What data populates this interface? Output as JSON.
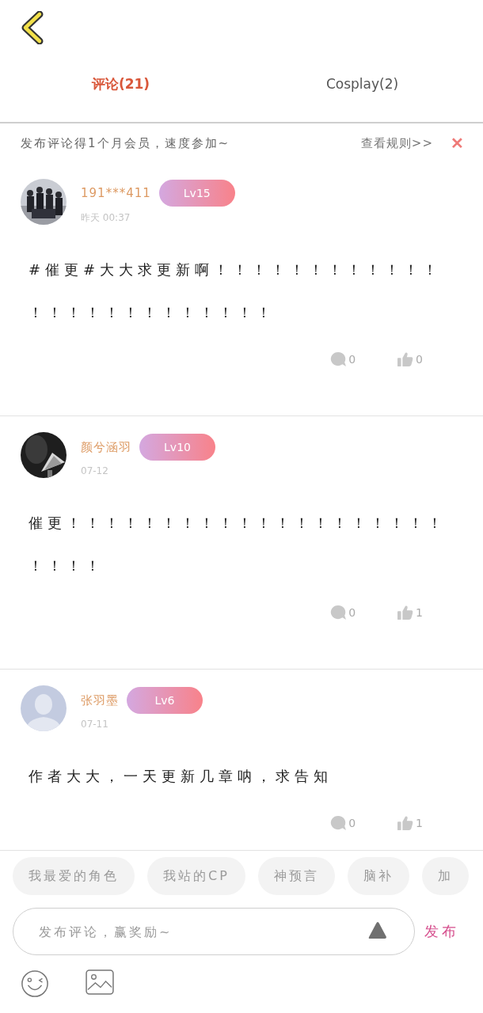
{
  "tabs": [
    {
      "label": "评论(21)",
      "selected": true
    },
    {
      "label": "Cosplay(2)",
      "selected": false
    }
  ],
  "banner": {
    "text": "发布评论得1个月会员，速度参加~",
    "link": "查看规则>>",
    "close": "✕"
  },
  "comments": [
    {
      "kind": "picture",
      "user": "191***411",
      "level": "Lv15",
      "time": "昨天 00:37",
      "text": "#催更#大大求更新啊！！！！！！！！！！！！！！！！！！！！！！！！！",
      "replies": "0",
      "likes": "0"
    },
    {
      "kind": "picture",
      "user": "颜兮涵羽",
      "level": "Lv10",
      "time": "07-12",
      "text": "催更！！！！！！！！！！！！！！！！！！！！！！！！",
      "replies": "0",
      "likes": "1"
    },
    {
      "kind": "silhouette",
      "user": "张羽墨",
      "level": "Lv6",
      "time": "07-11",
      "text": "作者大大，一天更新几章呐，求告知",
      "replies": "0",
      "likes": "1"
    }
  ],
  "chips": [
    "我最爱的角色",
    "我站的CP",
    "神预言",
    "脑补",
    "加"
  ],
  "input": {
    "placeholder": "发布评论，赢奖励~",
    "submit": "发布"
  }
}
